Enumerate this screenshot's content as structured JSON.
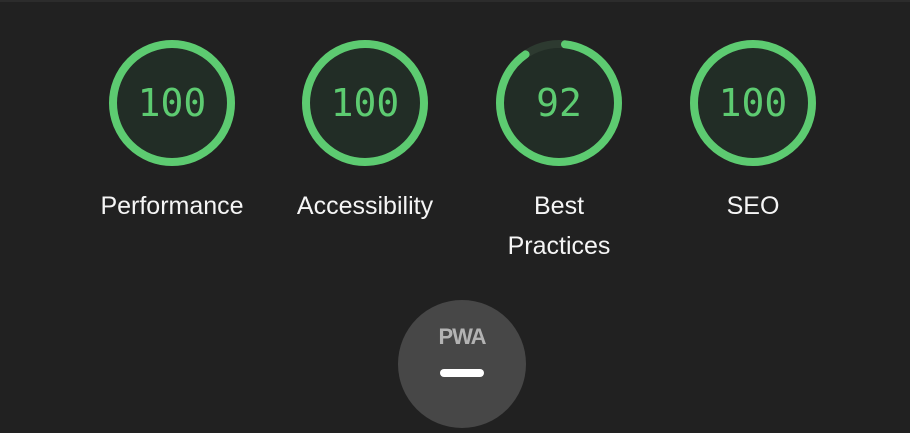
{
  "colors": {
    "pass": "#5dcb71",
    "pass_fill": "#222d26",
    "track": "#2d3a30",
    "pwa_bg": "#474747",
    "pwa_text": "#b3b3b3",
    "pwa_dash": "#ffffff"
  },
  "gauges": [
    {
      "score": 100,
      "score_text": "100",
      "label": "Performance"
    },
    {
      "score": 100,
      "score_text": "100",
      "label": "Accessibility"
    },
    {
      "score": 92,
      "score_text": "92",
      "label": "Best Practices"
    },
    {
      "score": 100,
      "score_text": "100",
      "label": "SEO"
    }
  ],
  "pwa": {
    "badge_text": "PWA",
    "status": "—"
  }
}
